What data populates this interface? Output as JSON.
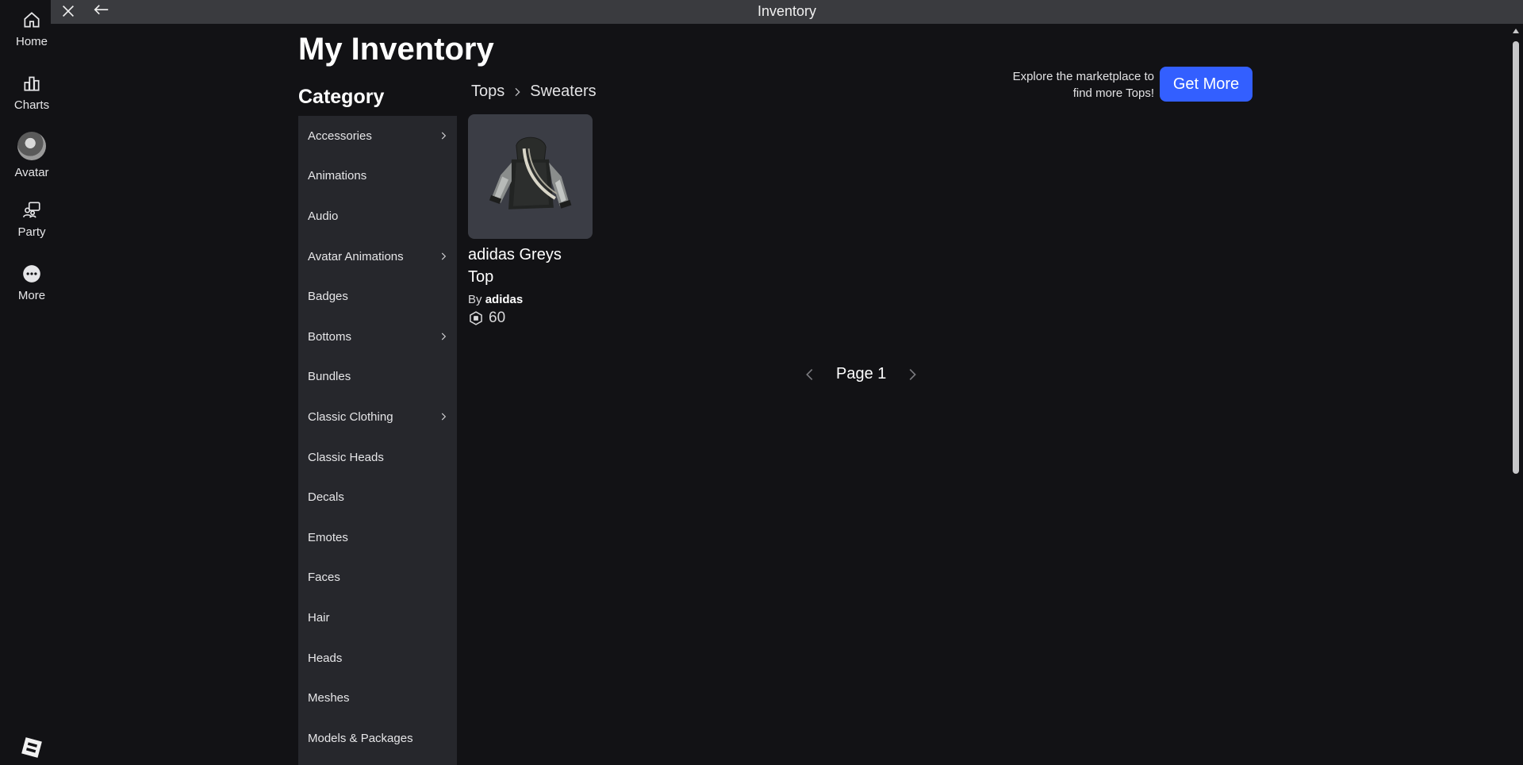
{
  "window": {
    "title": "Inventory"
  },
  "nav": {
    "items": [
      {
        "label": "Home",
        "icon": "home-icon"
      },
      {
        "label": "Charts",
        "icon": "charts-icon"
      },
      {
        "label": "Avatar",
        "icon": "avatar-icon"
      },
      {
        "label": "Party",
        "icon": "party-icon"
      },
      {
        "label": "More",
        "icon": "more-icon"
      }
    ]
  },
  "main": {
    "page_title": "My Inventory",
    "category_title": "Category",
    "breadcrumb": [
      "Tops",
      "Sweaters"
    ],
    "promo_text_line1": "Explore the marketplace to",
    "promo_text_line2": "find more Tops!",
    "get_more_label": "Get More",
    "categories": [
      {
        "label": "Accessories",
        "has_children": true
      },
      {
        "label": "Animations",
        "has_children": false
      },
      {
        "label": "Audio",
        "has_children": false
      },
      {
        "label": "Avatar Animations",
        "has_children": true
      },
      {
        "label": "Badges",
        "has_children": false
      },
      {
        "label": "Bottoms",
        "has_children": true
      },
      {
        "label": "Bundles",
        "has_children": false
      },
      {
        "label": "Classic Clothing",
        "has_children": true
      },
      {
        "label": "Classic Heads",
        "has_children": false
      },
      {
        "label": "Decals",
        "has_children": false
      },
      {
        "label": "Emotes",
        "has_children": false
      },
      {
        "label": "Faces",
        "has_children": false
      },
      {
        "label": "Hair",
        "has_children": false
      },
      {
        "label": "Heads",
        "has_children": false
      },
      {
        "label": "Meshes",
        "has_children": false
      },
      {
        "label": "Models & Packages",
        "has_children": false
      }
    ],
    "items": [
      {
        "name": "adidas Greys Top",
        "by_label": "By",
        "creator": "adidas",
        "price": "60"
      }
    ],
    "pager": {
      "label": "Page 1"
    }
  },
  "colors": {
    "accent": "#335fff",
    "background": "#121215",
    "panel": "#26272c",
    "titlebar": "#3a3b3f"
  }
}
